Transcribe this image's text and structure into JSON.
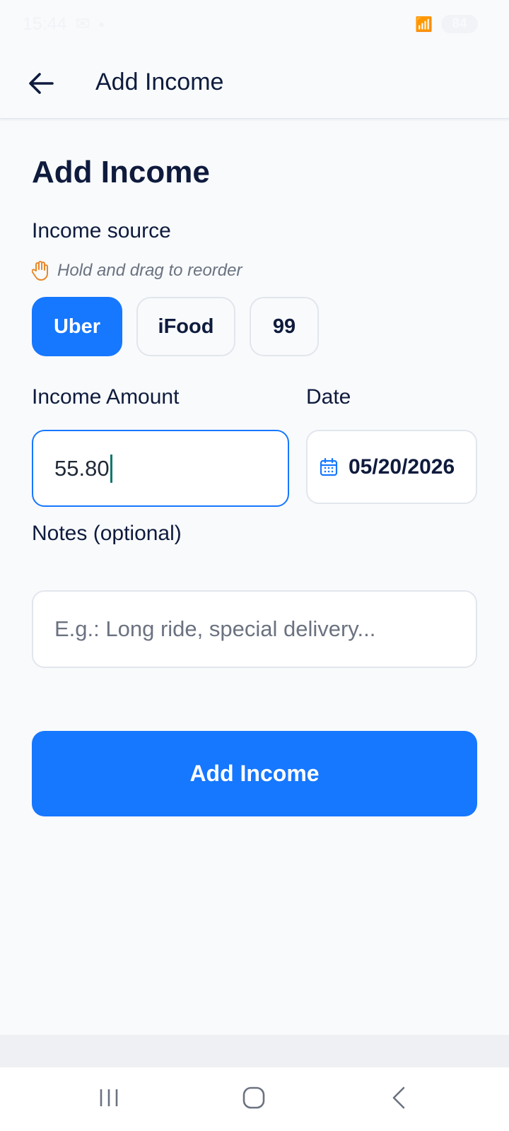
{
  "status_bar": {
    "time": "15:44",
    "battery": "84"
  },
  "app_bar": {
    "title": "Add Income"
  },
  "form": {
    "heading": "Add Income",
    "source_label": "Income source",
    "reorder_hint": "Hold and drag to reorder",
    "sources": [
      {
        "label": "Uber",
        "selected": true
      },
      {
        "label": "iFood",
        "selected": false
      },
      {
        "label": "99",
        "selected": false
      }
    ],
    "amount_label": "Income Amount",
    "amount_value": "55.80",
    "date_label": "Date",
    "date_value": "05/20/2026",
    "notes_label": "Notes (optional)",
    "notes_placeholder": "E.g.: Long ride, special delivery...",
    "submit_label": "Add Income"
  },
  "colors": {
    "accent": "#1677ff",
    "text": "#0f1b3d",
    "muted": "#6b7280",
    "background": "#f8fafc",
    "hint_icon": "#e8892b"
  },
  "icons": [
    "back-arrow-icon",
    "hand-icon",
    "calendar-icon",
    "recents-icon",
    "home-icon",
    "nav-back-icon"
  ]
}
